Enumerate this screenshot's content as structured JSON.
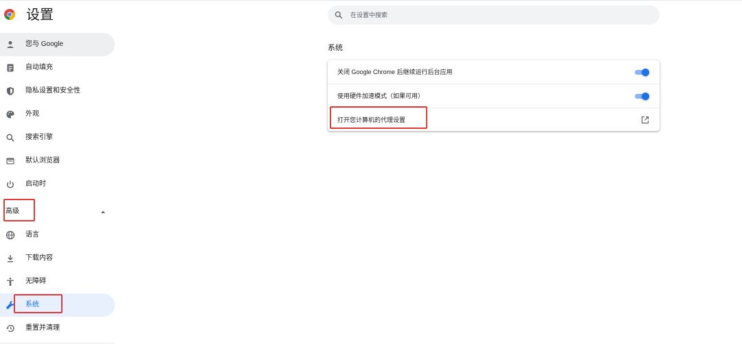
{
  "header": {
    "title": "设置",
    "logo_icon": "chrome-logo-icon"
  },
  "search": {
    "placeholder": "在设置中搜索"
  },
  "sidebar": {
    "items": [
      {
        "label": "您与 Google",
        "icon": "person-icon"
      },
      {
        "label": "自动填充",
        "icon": "clipboard-icon"
      },
      {
        "label": "隐私设置和安全性",
        "icon": "shield-icon"
      },
      {
        "label": "外观",
        "icon": "palette-icon"
      },
      {
        "label": "搜索引擎",
        "icon": "search-icon"
      },
      {
        "label": "默认浏览器",
        "icon": "browser-icon"
      },
      {
        "label": "启动时",
        "icon": "power-icon"
      }
    ],
    "advanced": {
      "label": "高级",
      "expanded": true
    },
    "advanced_items": [
      {
        "label": "语言",
        "icon": "globe-icon"
      },
      {
        "label": "下载内容",
        "icon": "download-icon"
      },
      {
        "label": "无障碍",
        "icon": "accessibility-icon"
      },
      {
        "label": "系统",
        "icon": "wrench-icon",
        "active": true
      },
      {
        "label": "重置并清理",
        "icon": "restore-icon"
      }
    ]
  },
  "main": {
    "section_title": "系统",
    "rows": [
      {
        "label": "关闭 Google Chrome 后继续运行后台应用",
        "control": "toggle",
        "checked": true
      },
      {
        "label": "使用硬件加速模式（如果可用）",
        "control": "toggle",
        "checked": true
      },
      {
        "label": "打开您计算机的代理设置",
        "control": "external-link-icon"
      }
    ]
  },
  "colors": {
    "accent": "#1a73e8",
    "toggle_track": "#8ab4f8",
    "annotation": "#e53935",
    "active_item_bg": "#e8f0fe"
  }
}
